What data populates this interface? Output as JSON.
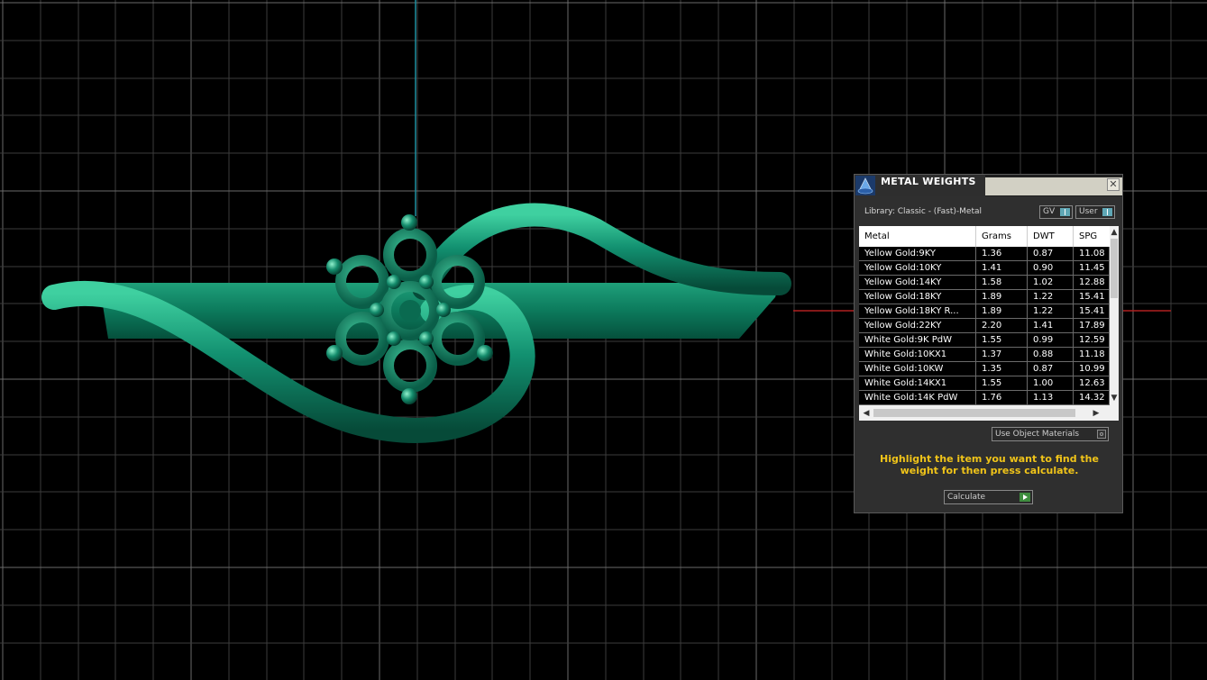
{
  "panel": {
    "title": "METAL WEIGHTS",
    "close_label": "✕",
    "library": "Library: Classic - (Fast)-Metal",
    "gv_label": "GV",
    "user_label": "User",
    "table": {
      "headers": [
        "Metal",
        "Grams",
        "DWT",
        "SPG"
      ],
      "rows": [
        [
          "Yellow Gold:9KY",
          "1.36",
          "0.87",
          "11.08"
        ],
        [
          "Yellow Gold:10KY",
          "1.41",
          "0.90",
          "11.45"
        ],
        [
          "Yellow Gold:14KY",
          "1.58",
          "1.02",
          "12.88"
        ],
        [
          "Yellow Gold:18KY",
          "1.89",
          "1.22",
          "15.41"
        ],
        [
          "Yellow Gold:18KY R...",
          "1.89",
          "1.22",
          "15.41"
        ],
        [
          "Yellow Gold:22KY",
          "2.20",
          "1.41",
          "17.89"
        ],
        [
          "White Gold:9K PdW",
          "1.55",
          "0.99",
          "12.59"
        ],
        [
          "White Gold:10KX1",
          "1.37",
          "0.88",
          "11.18"
        ],
        [
          "White Gold:10KW",
          "1.35",
          "0.87",
          "10.99"
        ],
        [
          "White Gold:14KX1",
          "1.55",
          "1.00",
          "12.63"
        ],
        [
          "White Gold:14K PdW",
          "1.76",
          "1.13",
          "14.32"
        ]
      ]
    },
    "use_object_materials": "Use Object Materials",
    "hint": "Highlight the item you want to find the weight for then press calculate.",
    "calculate_label": "Calculate"
  },
  "colors": {
    "background": "#000000",
    "grid": "#5a5a5a",
    "axis_vertical": "#1f8fa0",
    "axis_horizontal": "#b02020",
    "model": "#0f8a6a",
    "hint": "#f0c419"
  }
}
